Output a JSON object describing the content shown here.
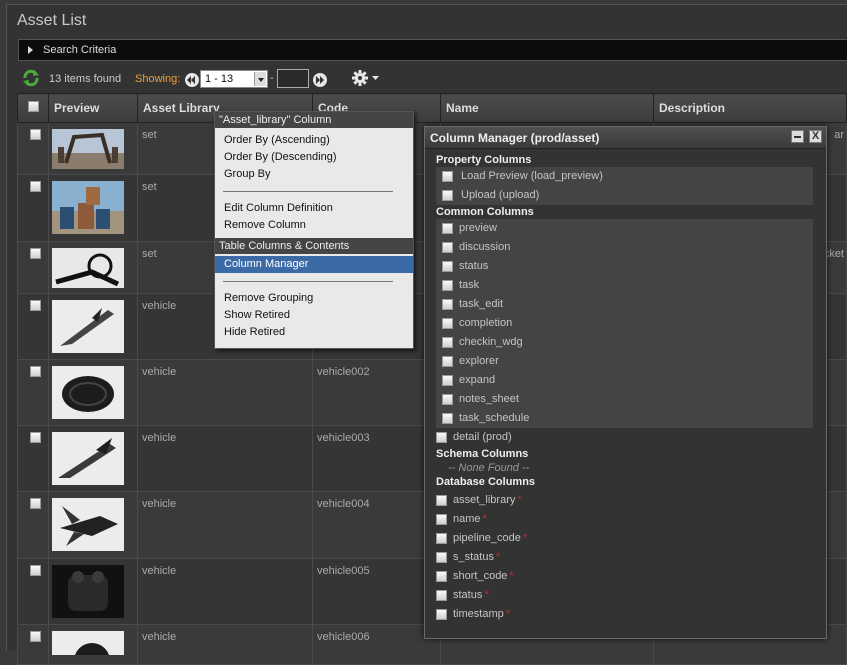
{
  "title": "Asset List",
  "search": {
    "label": "Search Criteria"
  },
  "toolbar": {
    "items_found": "13 items found",
    "showing_label": "Showing:",
    "range_value": "1 - 13",
    "dash": "-"
  },
  "table": {
    "headers": [
      "Preview",
      "Asset Library",
      "Code",
      "Name",
      "Description"
    ],
    "rows": [
      {
        "asset_library": "set",
        "code": ""
      },
      {
        "asset_library": "set",
        "code": ""
      },
      {
        "asset_library": "set",
        "code": ""
      },
      {
        "asset_library": "vehicle",
        "code": ""
      },
      {
        "asset_library": "vehicle",
        "code": "vehicle002"
      },
      {
        "asset_library": "vehicle",
        "code": "vehicle003"
      },
      {
        "asset_library": "vehicle",
        "code": "vehicle004"
      },
      {
        "asset_library": "vehicle",
        "code": "vehicle005"
      },
      {
        "asset_library": "vehicle",
        "code": "vehicle006"
      }
    ],
    "desc_snippets": [
      "ar",
      "",
      "cket"
    ]
  },
  "context_menu": {
    "header": "\"Asset_library\" Column",
    "items_a": [
      "Order By (Ascending)",
      "Order By (Descending)",
      "Group By"
    ],
    "items_b": [
      "Edit Column Definition",
      "Remove Column"
    ],
    "section2": "Table Columns & Contents",
    "active_item": "Column Manager",
    "items_c": [
      "Remove Grouping",
      "Show Retired",
      "Hide Retired"
    ]
  },
  "column_manager": {
    "title": "Column Manager (prod/asset)",
    "close": "X",
    "property_title": "Property Columns",
    "property": [
      "Load Preview (load_preview)",
      "Upload (upload)"
    ],
    "common_title": "Common Columns",
    "common": [
      "preview",
      "discussion",
      "status",
      "task",
      "task_edit",
      "completion",
      "checkin_wdg",
      "explorer",
      "expand",
      "notes_sheet",
      "task_schedule"
    ],
    "common_extra": "detail (prod)",
    "schema_title": "Schema Columns",
    "none_found": "-- None Found --",
    "database_title": "Database Columns",
    "database": [
      "asset_library",
      "name",
      "pipeline_code",
      "s_status",
      "short_code",
      "status",
      "timestamp"
    ],
    "required_mark": "*"
  },
  "colors": {
    "accent": "#e8a33a",
    "menu_active": "#3c6aa6",
    "required": "#b83030"
  }
}
